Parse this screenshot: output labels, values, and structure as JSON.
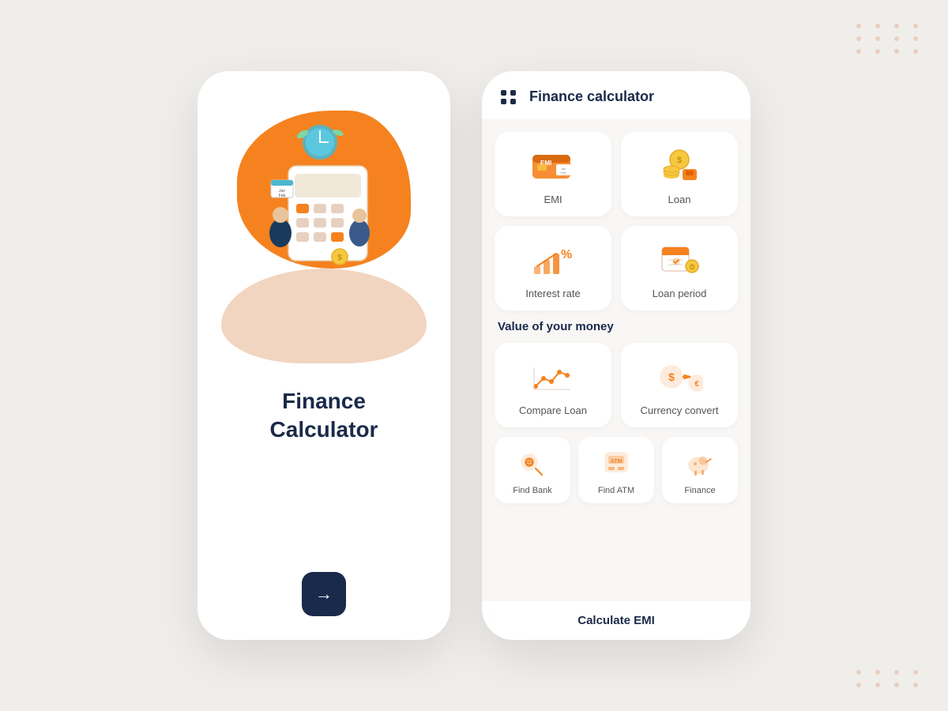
{
  "watermark": {
    "text": "Finance calculator"
  },
  "left_card": {
    "title_line1": "Finance",
    "title_line2": "Calculator",
    "arrow_label": "→"
  },
  "right_card": {
    "header_title": "Finance calculator",
    "features_row1": [
      {
        "id": "emi",
        "label": "EMI"
      },
      {
        "id": "loan",
        "label": "Loan"
      }
    ],
    "features_row2": [
      {
        "id": "interest-rate",
        "label": "Interest rate"
      },
      {
        "id": "loan-period",
        "label": "Loan period"
      }
    ],
    "section_value_money": "Value of your money",
    "features_row3": [
      {
        "id": "compare-loan",
        "label": "Compare Loan"
      },
      {
        "id": "currency-convert",
        "label": "Currency convert"
      }
    ],
    "features_row4": [
      {
        "id": "find-bank",
        "label": "Find Bank"
      },
      {
        "id": "find-atm",
        "label": "Find ATM"
      },
      {
        "id": "finance",
        "label": "Finance"
      }
    ],
    "bottom_cta": "Calculate EMI"
  },
  "dots": {
    "top_right_count": 12,
    "bottom_right_count": 8
  }
}
